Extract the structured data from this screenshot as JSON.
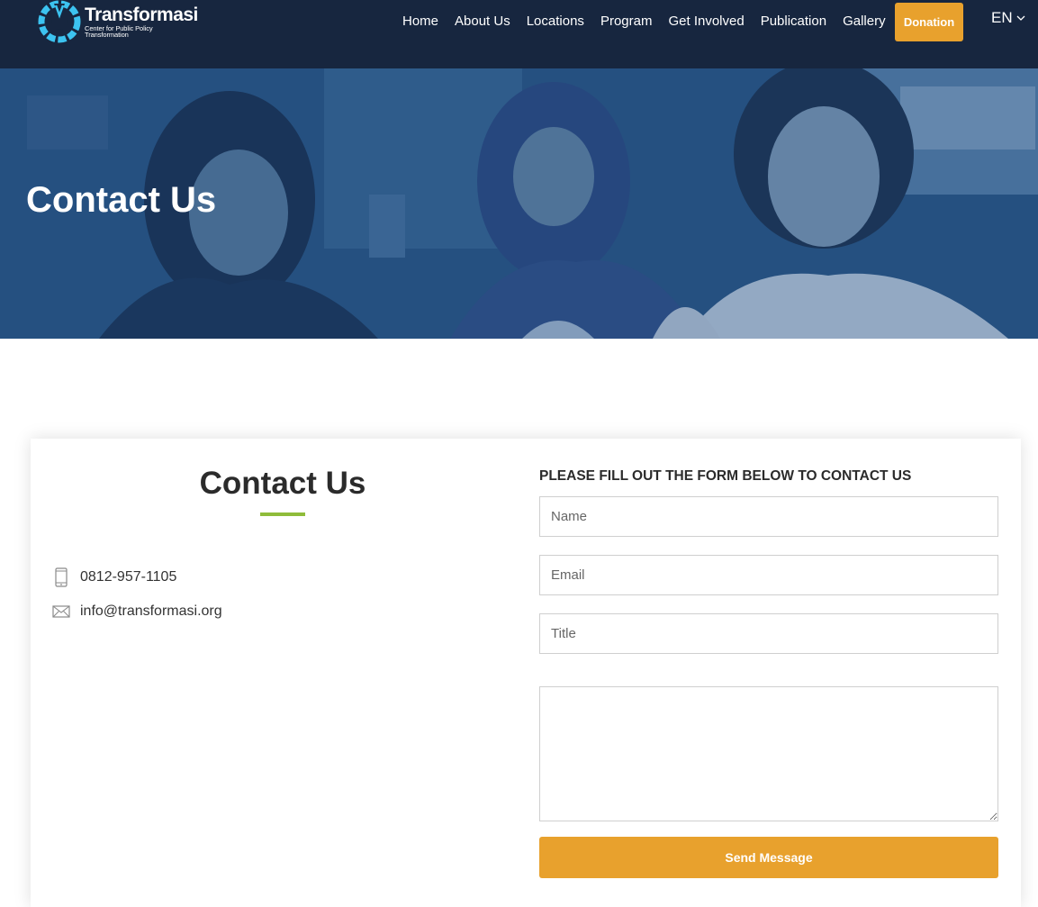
{
  "brand": {
    "name": "Transformasi",
    "tagline": "Center for Public Policy Transformation",
    "logo_icon": "circle-logo-icon"
  },
  "nav": {
    "items": [
      "Home",
      "About Us",
      "Locations",
      "Program",
      "Get Involved",
      "Publication",
      "Gallery"
    ],
    "donate_label": "Donation",
    "language": "EN"
  },
  "hero": {
    "title": "Contact Us"
  },
  "contact": {
    "title": "Contact Us",
    "phone": "0812-957-1105",
    "email": "info@transformasi.org",
    "phone_icon": "phone-icon",
    "email_icon": "envelope-icon"
  },
  "form": {
    "heading": "PLEASE FILL OUT THE FORM BELOW TO CONTACT US",
    "name_placeholder": "Name",
    "email_placeholder": "Email",
    "title_placeholder": "Title",
    "message_placeholder": "",
    "submit_label": "Send Message"
  },
  "colors": {
    "navbar": "#17263f",
    "accent_orange": "#e8a12d",
    "accent_green": "#8fbc3a",
    "hero_overlay": "#1c487d"
  }
}
